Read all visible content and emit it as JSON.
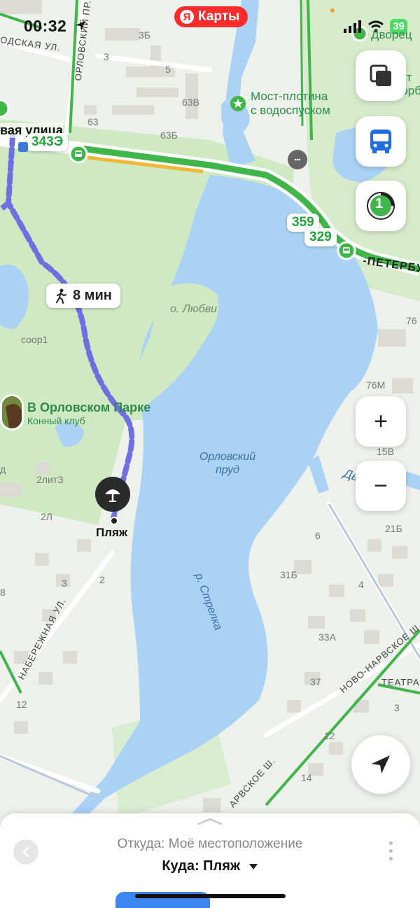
{
  "status_bar": {
    "time": "00:32",
    "battery": "39"
  },
  "brand": {
    "logo_letter": "Я",
    "title": "Карты"
  },
  "map": {
    "streets": {
      "street_left_top": "ОДСКАЯ УЛ.",
      "street_orlovsky": "ОРЛОВСКИЙ ПР.",
      "street_vaya": "вая улица",
      "street_peterburg": "-ПЕТЕРБУ",
      "street_naberezhnaya": "НАБЕРЕЖНАЯ УЛ.",
      "street_novo_narvskoe": "НОВО-НАРВСКОЕ Ш.",
      "street_teatr": "ТЕАТРА",
      "street_arvskoe": "АРВСКОЕ Ш.",
      "street_dvorts": "Дворцо"
    },
    "house_numbers": [
      "3Б",
      "3",
      "5",
      "63В",
      "63",
      "63Б",
      "76",
      "76М",
      "15В",
      "21Б",
      "6",
      "31Б",
      "4",
      "33А",
      "37",
      "3",
      "12",
      "14",
      "2литЗ",
      "2Л",
      "3",
      "2",
      "12",
      "8",
      "д"
    ],
    "labels": {
      "soor1": "соор1",
      "island": "о. Любви",
      "pond": "Орловский пруд",
      "river": "р. Стрелка",
      "right_top_poi": "Дворец",
      "right_top_poi_2": "кт",
      "right_top_poi_3": "огорб"
    },
    "poi_dam": {
      "line1": "Мост-плотина",
      "line2": "с водоспуском"
    },
    "poi_club": {
      "name": "В Орловском Парке",
      "subtitle": "Конный клуб"
    },
    "beach_label": "Пляж",
    "walk_time": "8 мин",
    "route_badges": [
      "343Э",
      "359",
      "329"
    ]
  },
  "controls": {
    "layers": "layers-icon",
    "transport": "bus-icon",
    "traffic_badge": "1",
    "zoom_in": "+",
    "zoom_out": "−",
    "locate": "navigation-arrow-icon"
  },
  "bottom_sheet": {
    "from_text": "Откуда: Моё местоположение",
    "to_text": "Куда: Пляж"
  },
  "colors": {
    "water": "#a9d2f5",
    "park": "#cfe9c3",
    "route_walk": "#6f6fe0",
    "road_green": "#3fb54a",
    "brand_red": "#ff2b2b"
  }
}
